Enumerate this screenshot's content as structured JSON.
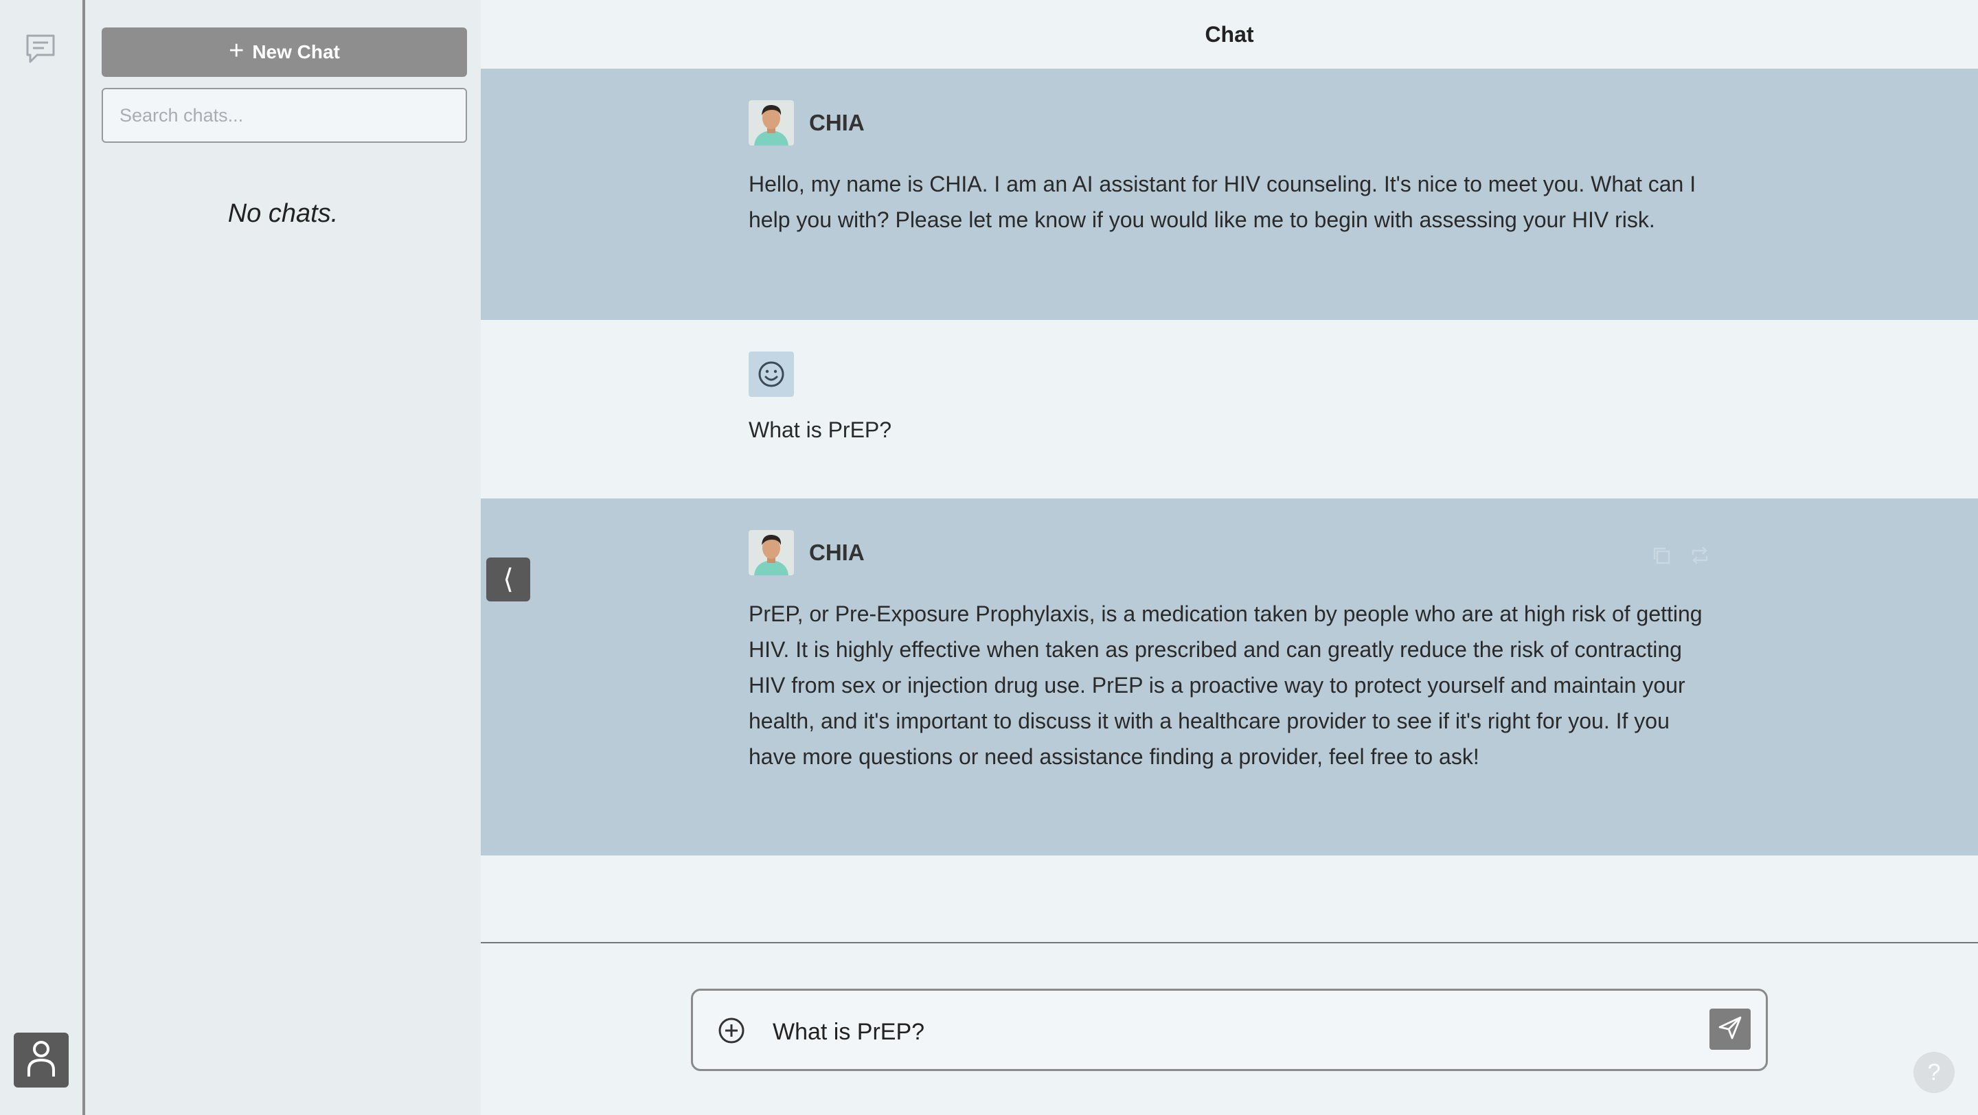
{
  "sidebar": {
    "new_chat_label": "New Chat",
    "search_placeholder": "Search chats...",
    "empty_text": "No chats."
  },
  "header": {
    "title": "Chat"
  },
  "messages": [
    {
      "role": "assistant",
      "sender": "CHIA",
      "text": "Hello, my name is CHIA. I am an AI assistant for HIV counseling. It's nice to meet you. What can I help you with? Please let me know if you would like me to begin with assessing your HIV risk."
    },
    {
      "role": "user",
      "text": "What is PrEP?"
    },
    {
      "role": "assistant",
      "sender": "CHIA",
      "text": "PrEP, or Pre-Exposure Prophylaxis, is a medication taken by people who are at high risk of getting HIV. It is highly effective when taken as prescribed and can greatly reduce the risk of contracting HIV from sex or injection drug use. PrEP is a proactive way to protect yourself and maintain your health, and it's important to discuss it with a healthcare provider to see if it's right for you. If you have more questions or need assistance finding a provider, feel free to ask!"
    }
  ],
  "composer": {
    "value": "What is PrEP?"
  },
  "collapse_glyph": "⟨",
  "help_glyph": "?",
  "icons": {
    "rail_chat": "chat-bubble-icon",
    "user": "user-icon",
    "attach": "plus-circle-icon",
    "send": "send-icon",
    "copy": "copy-icon",
    "regenerate": "regenerate-icon",
    "smiley": "smiley-icon"
  },
  "colors": {
    "assistant_bg": "#b8cbd7",
    "page_bg": "#eef3f6",
    "button_gray": "#8e8e8e"
  }
}
